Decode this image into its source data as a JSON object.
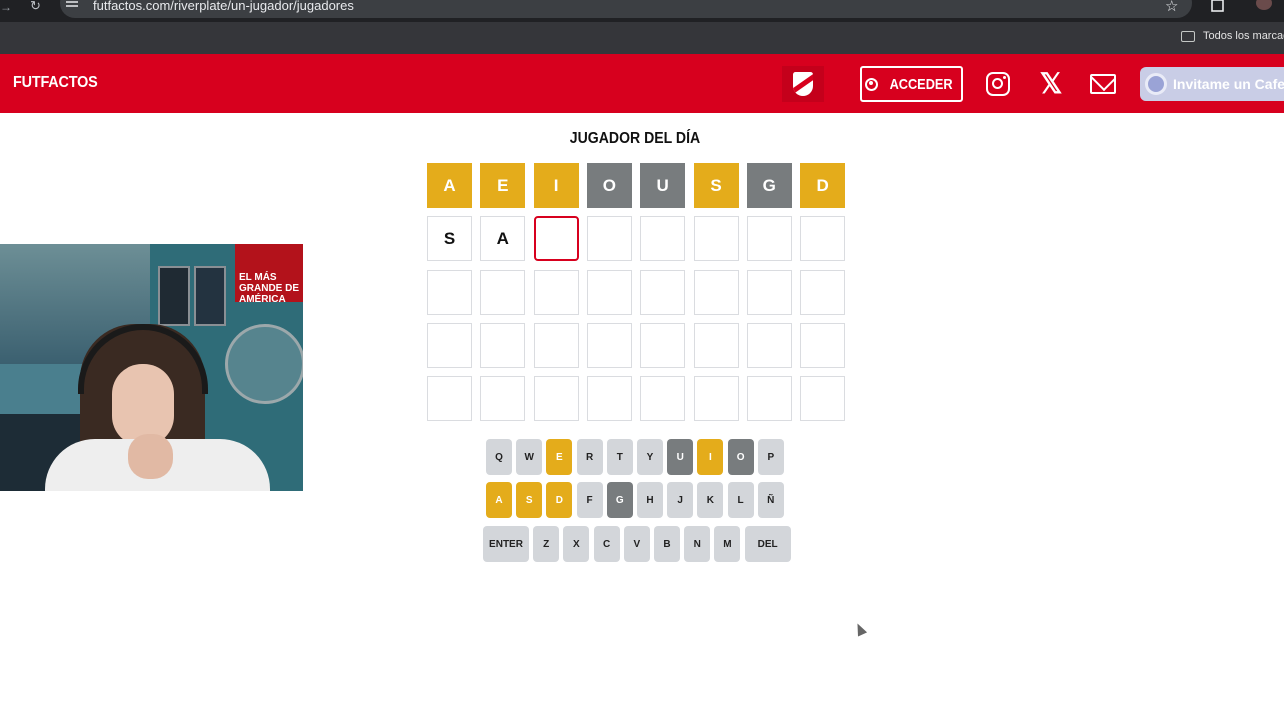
{
  "browser": {
    "url": "futfactos.com/riverplate/un-jugador/jugadores",
    "bookmarks_label": "Todos los marcad"
  },
  "header": {
    "logo": "FUTFACTOS",
    "login_label": "ACCEDER",
    "x_glyph": "𝕏",
    "coffee_label": "Invitame un Cafe",
    "brand_color": "#d7001e"
  },
  "game": {
    "title": "JUGADOR DEL DÍA",
    "colors": {
      "present": "#e4ac1b",
      "absent": "#787c7e"
    },
    "rows": [
      [
        {
          "l": "A",
          "s": "present"
        },
        {
          "l": "E",
          "s": "present"
        },
        {
          "l": "I",
          "s": "present"
        },
        {
          "l": "O",
          "s": "absent"
        },
        {
          "l": "U",
          "s": "absent"
        },
        {
          "l": "S",
          "s": "present"
        },
        {
          "l": "G",
          "s": "absent"
        },
        {
          "l": "D",
          "s": "present"
        }
      ],
      [
        {
          "l": "S",
          "s": "empty"
        },
        {
          "l": "A",
          "s": "empty"
        },
        {
          "l": "",
          "s": "active"
        },
        {
          "l": "",
          "s": "empty"
        },
        {
          "l": "",
          "s": "empty"
        },
        {
          "l": "",
          "s": "empty"
        },
        {
          "l": "",
          "s": "empty"
        },
        {
          "l": "",
          "s": "empty"
        }
      ],
      [
        {
          "l": "",
          "s": "empty"
        },
        {
          "l": "",
          "s": "empty"
        },
        {
          "l": "",
          "s": "empty"
        },
        {
          "l": "",
          "s": "empty"
        },
        {
          "l": "",
          "s": "empty"
        },
        {
          "l": "",
          "s": "empty"
        },
        {
          "l": "",
          "s": "empty"
        },
        {
          "l": "",
          "s": "empty"
        }
      ],
      [
        {
          "l": "",
          "s": "empty"
        },
        {
          "l": "",
          "s": "empty"
        },
        {
          "l": "",
          "s": "empty"
        },
        {
          "l": "",
          "s": "empty"
        },
        {
          "l": "",
          "s": "empty"
        },
        {
          "l": "",
          "s": "empty"
        },
        {
          "l": "",
          "s": "empty"
        },
        {
          "l": "",
          "s": "empty"
        }
      ],
      [
        {
          "l": "",
          "s": "empty"
        },
        {
          "l": "",
          "s": "empty"
        },
        {
          "l": "",
          "s": "empty"
        },
        {
          "l": "",
          "s": "empty"
        },
        {
          "l": "",
          "s": "empty"
        },
        {
          "l": "",
          "s": "empty"
        },
        {
          "l": "",
          "s": "empty"
        },
        {
          "l": "",
          "s": "empty"
        }
      ]
    ],
    "keyboard": [
      [
        {
          "k": "Q",
          "s": ""
        },
        {
          "k": "W",
          "s": ""
        },
        {
          "k": "E",
          "s": "present"
        },
        {
          "k": "R",
          "s": ""
        },
        {
          "k": "T",
          "s": ""
        },
        {
          "k": "Y",
          "s": ""
        },
        {
          "k": "U",
          "s": "absent"
        },
        {
          "k": "I",
          "s": "present"
        },
        {
          "k": "O",
          "s": "absent"
        },
        {
          "k": "P",
          "s": ""
        }
      ],
      [
        {
          "k": "A",
          "s": "present"
        },
        {
          "k": "S",
          "s": "present"
        },
        {
          "k": "D",
          "s": "present"
        },
        {
          "k": "F",
          "s": ""
        },
        {
          "k": "G",
          "s": "absent"
        },
        {
          "k": "H",
          "s": ""
        },
        {
          "k": "J",
          "s": ""
        },
        {
          "k": "K",
          "s": ""
        },
        {
          "k": "L",
          "s": ""
        },
        {
          "k": "Ñ",
          "s": ""
        }
      ],
      [
        {
          "k": "ENTER",
          "s": ""
        },
        {
          "k": "Z",
          "s": ""
        },
        {
          "k": "X",
          "s": ""
        },
        {
          "k": "C",
          "s": ""
        },
        {
          "k": "V",
          "s": ""
        },
        {
          "k": "B",
          "s": ""
        },
        {
          "k": "N",
          "s": ""
        },
        {
          "k": "M",
          "s": ""
        },
        {
          "k": "DEL",
          "s": ""
        }
      ]
    ]
  },
  "webcam": {
    "poster_text": "EL MÁS GRANDE DE AMÉRICA"
  }
}
